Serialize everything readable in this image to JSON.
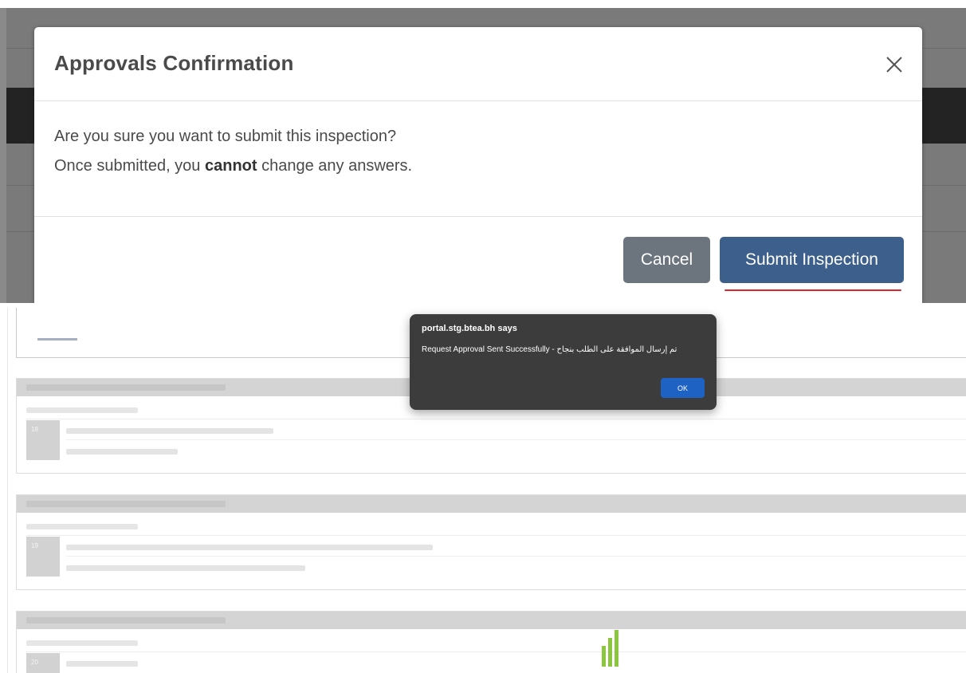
{
  "modal": {
    "title": "Approvals Confirmation",
    "close_glyph": "×",
    "body_line_1": "Are you sure you want to submit this inspection?",
    "body_line_2_before": "Once submitted, you ",
    "body_line_2_bold": "cannot",
    "body_line_2_after": " change any answers.",
    "cancel_label": "Cancel",
    "submit_label": "Submit Inspection",
    "submit_color": "#3d5f8c",
    "cancel_color": "#6c757d",
    "highlight_color": "#e0262b"
  },
  "alert": {
    "title": "portal.stg.btea.bh says",
    "message": "Request Approval Sent Successfully - تم إرسال الموافقة على الطلب بنجاح",
    "ok_label": "OK"
  },
  "background_cards": [
    {
      "number": "18"
    },
    {
      "number": "19"
    },
    {
      "number": "20"
    }
  ],
  "icons": {
    "close": "close-icon",
    "loader": "loading-bars-icon"
  }
}
